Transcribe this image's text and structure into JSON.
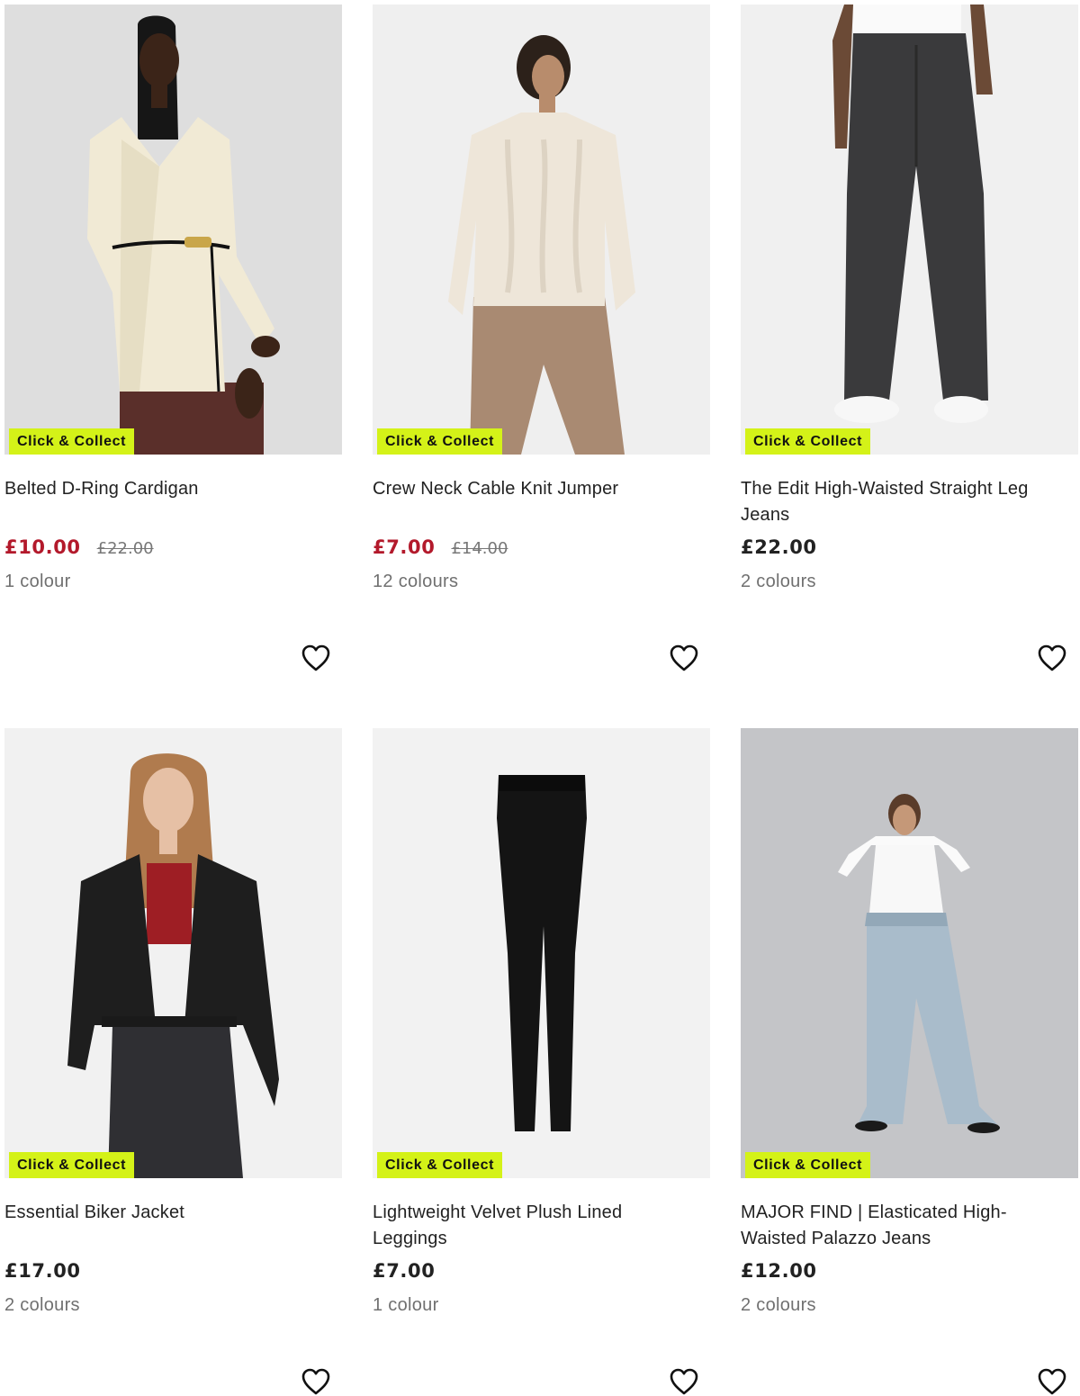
{
  "badge_color": "#d4f218",
  "sale_color": "#b3192b",
  "products": [
    {
      "title": "Belted D-Ring Cardigan",
      "badge": "Click & Collect",
      "price": "£10.00",
      "old_price": "£22.00",
      "colours": "1 colour",
      "on_sale": true,
      "wishlist_icon": "heart-outline-icon"
    },
    {
      "title": "Crew Neck Cable Knit Jumper",
      "badge": "Click & Collect",
      "price": "£7.00",
      "old_price": "£14.00",
      "colours": "12 colours",
      "on_sale": true,
      "wishlist_icon": "heart-outline-icon"
    },
    {
      "title": "The Edit High-Waisted Straight Leg Jeans",
      "badge": "Click & Collect",
      "price": "£22.00",
      "colours": "2 colours",
      "on_sale": false,
      "wishlist_icon": "heart-outline-icon"
    },
    {
      "title": "Essential Biker Jacket",
      "badge": "Click & Collect",
      "price": "£17.00",
      "colours": "2 colours",
      "on_sale": false,
      "wishlist_icon": "heart-outline-icon"
    },
    {
      "title": "Lightweight Velvet Plush Lined Leggings",
      "badge": "Click & Collect",
      "price": "£7.00",
      "colours": "1 colour",
      "on_sale": false,
      "wishlist_icon": "heart-outline-icon"
    },
    {
      "title": "MAJOR FIND | Elasticated High-Waisted Palazzo Jeans",
      "badge": "Click & Collect",
      "price": "£12.00",
      "colours": "2 colours",
      "on_sale": false,
      "wishlist_icon": "heart-outline-icon"
    }
  ]
}
